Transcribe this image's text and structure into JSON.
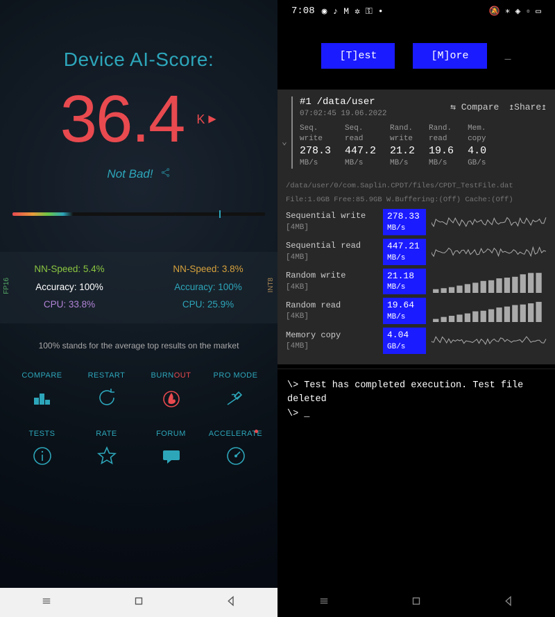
{
  "left": {
    "title": "Device AI-Score:",
    "score": "36.4",
    "score_suffix": "K",
    "rating_text": "Not Bad!",
    "avg_note": "100% stands for the average top results on the market",
    "fp16_tag": "FP16",
    "int8_tag": "INT8",
    "metrics": {
      "fp16": {
        "nn_label": "NN-Speed:",
        "nn_val": "5.4%",
        "nn_color": "#8bc640",
        "acc_label": "Accuracy:",
        "acc_val": "100%",
        "acc_color": "#ffffff",
        "cpu_label": "CPU:",
        "cpu_val": "33.8%",
        "cpu_color": "#b284d8"
      },
      "int8": {
        "nn_label": "NN-Speed:",
        "nn_val": "3.8%",
        "nn_color": "#d6a13c",
        "acc_label": "Accuracy:",
        "acc_val": "100%",
        "acc_color": "#2da6ba",
        "cpu_label": "CPU:",
        "cpu_val": "25.9%",
        "cpu_color": "#2da6ba"
      }
    },
    "actions": [
      {
        "id": "compare",
        "label": "COMPARE",
        "icon": "podium-icon"
      },
      {
        "id": "restart",
        "label": "RESTART",
        "icon": "refresh-icon"
      },
      {
        "id": "burnout",
        "label_a": "BURN",
        "label_b": "OUT",
        "icon": "flame-icon"
      },
      {
        "id": "promode",
        "label": "PRO MODE",
        "icon": "witch-icon"
      },
      {
        "id": "tests",
        "label": "TESTS",
        "icon": "info-icon"
      },
      {
        "id": "rate",
        "label": "RATE",
        "icon": "star-icon"
      },
      {
        "id": "forum",
        "label": "FORUM",
        "icon": "chat-icon"
      },
      {
        "id": "accelerate",
        "label": "ACCELERATE",
        "icon": "gauge-icon",
        "dot": true
      }
    ]
  },
  "right": {
    "status": {
      "time": "7:08"
    },
    "buttons": {
      "test": "[T]est",
      "more": "[M]ore"
    },
    "summary": {
      "index": "#1",
      "path": "/data/user",
      "timestamp": "07:02:45 19.06.2022",
      "compare": "Compare",
      "share": "Share",
      "cols": [
        {
          "label": "Seq.\nwrite",
          "value": "278.3",
          "unit": "MB/s"
        },
        {
          "label": "Seq.\nread",
          "value": "447.2",
          "unit": "MB/s"
        },
        {
          "label": "Rand.\nwrite",
          "value": "21.2",
          "unit": "MB/s"
        },
        {
          "label": "Rand.\nread",
          "value": "19.6",
          "unit": "MB/s"
        },
        {
          "label": "Mem.\ncopy",
          "value": "4.0",
          "unit": "GB/s"
        }
      ]
    },
    "file_meta_1": "/data/user/0/com.Saplin.CPDT/files/CPDT_TestFile.dat",
    "file_meta_2": "File:1.0GB Free:85.9GB W.Buffering:(Off) Cache:(Off)",
    "details": [
      {
        "name": "Sequential write",
        "block": "[4MB]",
        "value": "278.33",
        "unit": "MB/s",
        "graph": "noise"
      },
      {
        "name": "Sequential read",
        "block": "[4MB]",
        "value": "447.21",
        "unit": "MB/s",
        "graph": "noise"
      },
      {
        "name": "Random write",
        "block": "[4KB]",
        "value": "21.18",
        "unit": "MB/s",
        "graph": "bars-asc"
      },
      {
        "name": "Random read",
        "block": "[4KB]",
        "value": "19.64",
        "unit": "MB/s",
        "graph": "bars-asc"
      },
      {
        "name": "Memory copy",
        "block": "[4MB]",
        "value": "4.04",
        "unit": "GB/s",
        "graph": "noise"
      }
    ],
    "console_line1": "\\> Test has completed execution. Test file deleted",
    "console_line2": "\\> _"
  }
}
